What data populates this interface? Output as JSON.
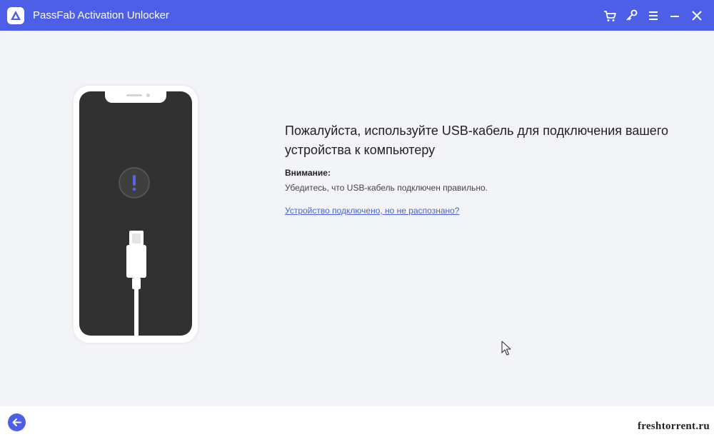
{
  "window": {
    "title": "PassFab Activation Unlocker",
    "accent_color": "#4d5fe6"
  },
  "toolbar": {
    "icons": [
      "cart-icon",
      "key-icon",
      "menu-icon",
      "minimize-icon",
      "close-icon"
    ]
  },
  "main": {
    "heading": "Пожалуйста, используйте USB-кабель для подключения вашего устройства к компьютеру",
    "attention_title": "Внимание:",
    "attention_text": "Убедитесь, что USB-кабель подключен правильно.",
    "help_link": "Устройство подключено, но не распознано?",
    "illustration": {
      "device": "phone",
      "status_icon": "exclamation-icon",
      "cable": "usb-cable"
    }
  },
  "footer": {
    "back_icon": "arrow-left-icon",
    "watermark": "freshtorrent.ru"
  }
}
